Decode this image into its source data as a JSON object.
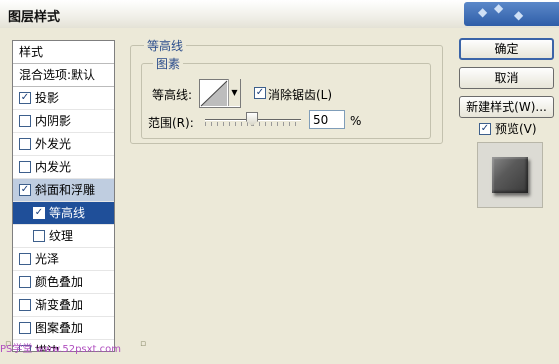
{
  "window": {
    "title": "图层样式"
  },
  "sidebar": {
    "header": "样式",
    "blend_options": "混合选项:默认",
    "items": [
      {
        "label": "投影",
        "checked": true
      },
      {
        "label": "内阴影",
        "checked": false
      },
      {
        "label": "外发光",
        "checked": false
      },
      {
        "label": "内发光",
        "checked": false
      },
      {
        "label": "斜面和浮雕",
        "checked": true,
        "selected": true
      },
      {
        "label": "等高线",
        "checked": true,
        "sub": true,
        "active": true
      },
      {
        "label": "纹理",
        "checked": false,
        "sub": true
      },
      {
        "label": "光泽",
        "checked": false
      },
      {
        "label": "颜色叠加",
        "checked": false
      },
      {
        "label": "渐变叠加",
        "checked": false
      },
      {
        "label": "图案叠加",
        "checked": false
      },
      {
        "label": "描边",
        "checked": false
      }
    ]
  },
  "panel": {
    "group_title": "等高线",
    "subgroup_title": "图素",
    "contour_label": "等高线:",
    "antialias_label": "消除锯齿(L)",
    "antialias_checked": true,
    "range_label": "范围(R):",
    "range_value": "50",
    "range_unit": "%"
  },
  "buttons": {
    "ok": "确定",
    "cancel": "取消",
    "new_style": "新建样式(W)...",
    "preview_label": "预览(V)",
    "preview_checked": true
  },
  "watermark": "PS学堂 www.52psxt.com"
}
